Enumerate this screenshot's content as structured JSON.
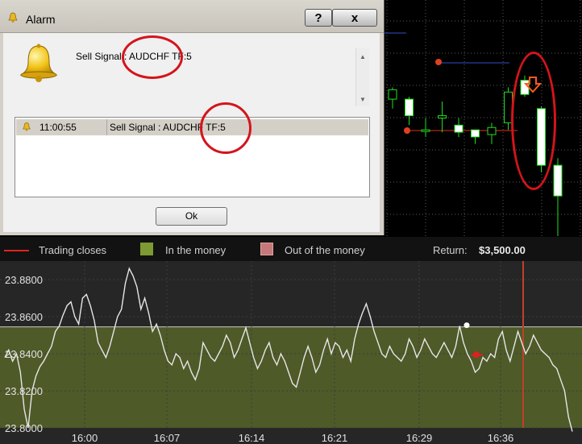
{
  "alarm_dialog": {
    "title": "Alarm",
    "help_button": "?",
    "close_button": "x",
    "message": "Sell Signal : AUDCHF TF:5",
    "history": [
      {
        "time": "11:00:55",
        "message": "Sell Signal : AUDCHF TF:5"
      }
    ],
    "ok_label": "Ok"
  },
  "trading_chart": {
    "legend": {
      "closes_label": "Trading closes",
      "in_money_label": "In the money",
      "out_money_label": "Out of the money",
      "return_label": "Return:",
      "return_value": "$3,500.00"
    },
    "colors": {
      "background": "#262626",
      "in_money_zone": "#4e5a28",
      "in_money_swatch": "#7e9a32",
      "out_money_swatch": "#c5787a",
      "price_line": "#e6e6e6",
      "close_line": "#c0402a",
      "entry_marker": "#e02020"
    }
  },
  "chart_data": [
    {
      "type": "line",
      "yticks": [
        "23.8000",
        "23.8200",
        "23.8400",
        "23.8600",
        "23.8800"
      ],
      "xticks": [
        "16:00",
        "16:07",
        "16:14",
        "16:21",
        "16:29",
        "16:36"
      ],
      "ylim": [
        23.8,
        23.89
      ],
      "in_money_range": [
        23.8,
        23.8545
      ],
      "entry_level": 23.8545,
      "entry_time_index": 0.83,
      "series": [
        {
          "values": [
            23.838,
            23.842,
            23.836,
            23.84,
            23.83,
            23.81,
            23.8,
            23.82,
            23.828,
            23.833,
            23.836,
            23.84,
            23.844,
            23.852,
            23.855,
            23.861,
            23.866,
            23.868,
            23.86,
            23.856,
            23.87,
            23.872,
            23.866,
            23.858,
            23.846,
            23.842,
            23.838,
            23.844,
            23.852,
            23.86,
            23.864,
            23.878,
            23.886,
            23.882,
            23.876,
            23.864,
            23.87,
            23.862,
            23.852,
            23.856,
            23.85,
            23.842,
            23.836,
            23.834,
            23.84,
            23.838,
            23.832,
            23.836,
            23.83,
            23.826,
            23.832,
            23.846,
            23.842,
            23.838,
            23.836,
            23.84,
            23.844,
            23.85,
            23.846,
            23.838,
            23.842,
            23.848,
            23.854,
            23.846,
            23.838,
            23.832,
            23.836,
            23.842,
            23.846,
            23.838,
            23.834,
            23.84,
            23.836,
            23.83,
            23.824,
            23.822,
            23.83,
            23.838,
            23.844,
            23.838,
            23.83,
            23.834,
            23.842,
            23.848,
            23.84,
            23.846,
            23.844,
            23.838,
            23.842,
            23.836,
            23.848,
            23.856,
            23.862,
            23.867,
            23.86,
            23.852,
            23.846,
            23.84,
            23.838,
            23.844,
            23.84,
            23.838,
            23.836,
            23.84,
            23.848,
            23.844,
            23.838,
            23.842,
            23.848,
            23.844,
            23.84,
            23.838,
            23.842,
            23.846,
            23.842,
            23.838,
            23.844,
            23.855,
            23.846,
            23.84,
            23.836,
            23.83,
            23.832,
            23.838,
            23.836,
            23.84,
            23.838,
            23.848,
            23.852,
            23.842,
            23.836,
            23.844,
            23.852,
            23.846,
            23.84,
            23.844,
            23.85,
            23.846,
            23.842,
            23.84,
            23.838,
            23.834,
            23.832,
            23.826,
            23.82,
            23.806,
            23.798
          ]
        }
      ]
    },
    {
      "type": "candlestick",
      "candles": [
        {
          "o": 0.62,
          "c": 0.58,
          "h": 0.63,
          "l": 0.54,
          "bull": true
        },
        {
          "o": 0.58,
          "c": 0.51,
          "h": 0.59,
          "l": 0.47,
          "bull": false
        },
        {
          "o": 0.45,
          "c": 0.45,
          "h": 0.5,
          "l": 0.42,
          "bull": true
        },
        {
          "o": 0.5,
          "c": 0.51,
          "h": 0.57,
          "l": 0.44,
          "bull": true
        },
        {
          "o": 0.47,
          "c": 0.44,
          "h": 0.5,
          "l": 0.42,
          "bull": false
        },
        {
          "o": 0.45,
          "c": 0.42,
          "h": 0.45,
          "l": 0.39,
          "bull": false
        },
        {
          "o": 0.46,
          "c": 0.43,
          "h": 0.48,
          "l": 0.39,
          "bull": true
        },
        {
          "o": 0.61,
          "c": 0.48,
          "h": 0.63,
          "l": 0.45,
          "bull": true
        },
        {
          "o": 0.66,
          "c": 0.6,
          "h": 0.68,
          "l": 0.59,
          "bull": false
        },
        {
          "o": 0.54,
          "c": 0.3,
          "h": 0.55,
          "l": 0.27,
          "bull": false
        },
        {
          "o": 0.3,
          "c": 0.17,
          "h": 0.33,
          "l": 0.0,
          "bull": false
        }
      ]
    }
  ]
}
